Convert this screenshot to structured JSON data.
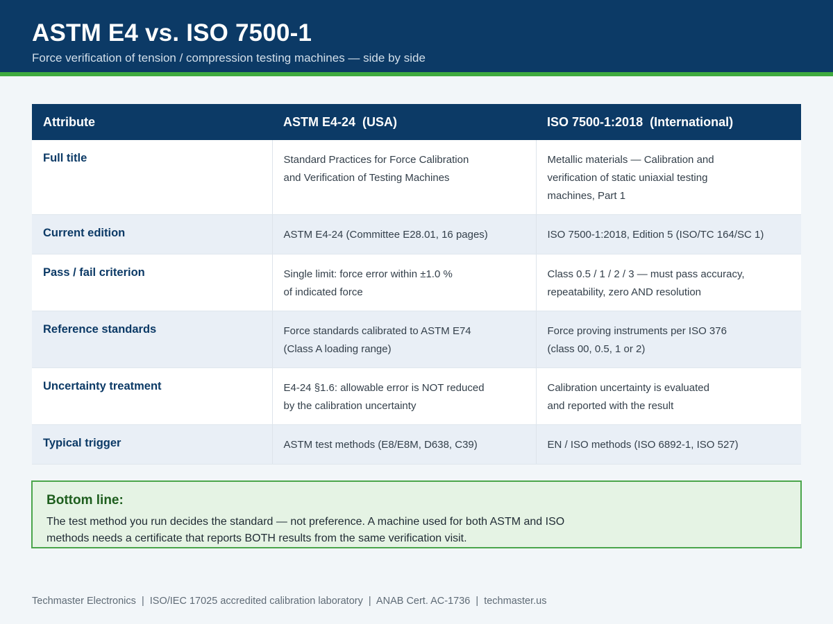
{
  "header": {
    "title": "ASTM E4 vs. ISO 7500-1",
    "subtitle": "Force verification of tension / compression testing machines — side by side"
  },
  "table": {
    "headers": [
      "Attribute",
      "ASTM E4-24  (USA)",
      "ISO 7500-1:2018  (International)"
    ],
    "rows": [
      {
        "attribute": "Full title",
        "astm": [
          "Standard Practices for Force Calibration",
          "and Verification of Testing Machines"
        ],
        "iso": [
          "Metallic materials — Calibration and",
          "verification of static uniaxial testing",
          "machines, Part 1"
        ]
      },
      {
        "attribute": "Current edition",
        "astm": [
          "ASTM E4-24 (Committee E28.01, 16 pages)"
        ],
        "iso": [
          "ISO 7500-1:2018, Edition 5 (ISO/TC 164/SC 1)"
        ]
      },
      {
        "attribute": "Pass / fail criterion",
        "astm": [
          "Single limit: force error within ±1.0 %",
          "of indicated force"
        ],
        "iso": [
          "Class 0.5 / 1 / 2 / 3 — must pass accuracy,",
          "repeatability, zero AND resolution"
        ]
      },
      {
        "attribute": "Reference standards",
        "astm": [
          "Force standards calibrated to ASTM E74",
          "(Class A loading range)"
        ],
        "iso": [
          "Force proving instruments per ISO 376",
          "(class 00, 0.5, 1 or 2)"
        ]
      },
      {
        "attribute": "Uncertainty treatment",
        "astm": [
          "E4-24 §1.6: allowable error is NOT reduced",
          "by the calibration uncertainty"
        ],
        "iso": [
          "Calibration uncertainty is evaluated",
          "and reported with the result"
        ]
      },
      {
        "attribute": "Typical trigger",
        "astm": [
          "ASTM test methods (E8/E8M, D638, C39)"
        ],
        "iso": [
          "EN / ISO methods (ISO 6892-1, ISO 527)"
        ]
      }
    ]
  },
  "bottom_line": {
    "title": "Bottom line:",
    "lines": [
      "The test method you run decides the standard — not preference. A machine used for both ASTM and ISO",
      "methods needs a certificate that reports BOTH results from the same verification visit."
    ]
  },
  "footer": {
    "text": "Techmaster Electronics  |  ISO/IEC 17025 accredited calibration laboratory  |  ANAB Cert. AC-1736  |  techmaster.us"
  },
  "colors": {
    "header_bg": "#0c3a66",
    "accent_green": "#3faa3f",
    "callout_bg": "#e5f3e4",
    "callout_border": "#4aa54a",
    "row_alt": "#e9eff6"
  }
}
